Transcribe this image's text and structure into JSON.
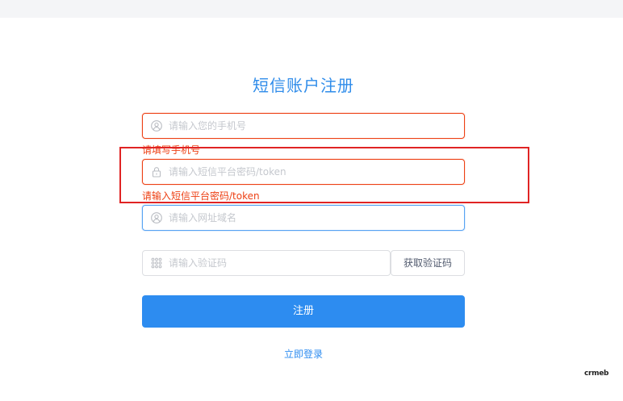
{
  "page": {
    "title": "短信账户注册"
  },
  "form": {
    "phone": {
      "placeholder": "请输入您的手机号",
      "value": "",
      "error": "请填写手机号",
      "icon": "user-icon"
    },
    "password": {
      "placeholder": "请输入短信平台密码/token",
      "value": "",
      "error": "请输入短信平台密码/token",
      "icon": "lock-icon"
    },
    "domain": {
      "placeholder": "请输入网址域名",
      "value": "",
      "icon": "user-icon"
    },
    "code": {
      "placeholder": "请输入验证码",
      "value": "",
      "icon": "grid-icon",
      "button_label": "获取验证码"
    },
    "submit_label": "注册",
    "login_link": "立即登录"
  },
  "footer": {
    "logo_text": "crmeb"
  },
  "colors": {
    "accent": "#2d8cf0",
    "error": "#ed4014",
    "annotation": "#e02424"
  }
}
